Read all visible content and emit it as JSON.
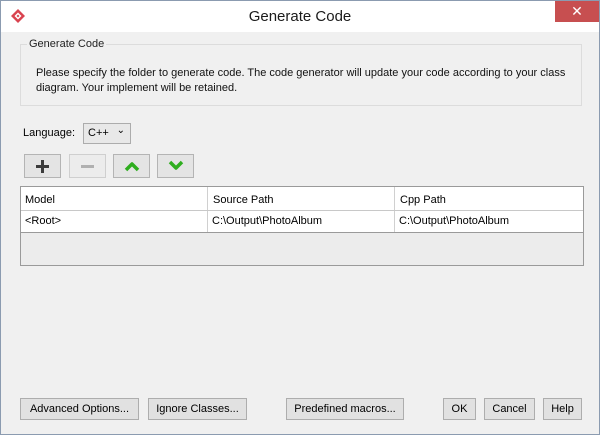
{
  "window": {
    "title": "Generate Code",
    "close_glyph": "✕"
  },
  "group": {
    "title": "Generate Code",
    "description": "Please specify the folder to generate code. The code generator will update your code according to your class diagram. Your implement will be retained."
  },
  "language": {
    "label": "Language:",
    "value": "C++"
  },
  "toolbar": {
    "add_icon": "plus-icon",
    "remove_icon": "minus-icon",
    "up_icon": "chevron-up-icon",
    "down_icon": "chevron-down-icon",
    "accent": "#2fae1f"
  },
  "table": {
    "columns": [
      "Model",
      "Source Path",
      "Cpp Path"
    ],
    "rows": [
      [
        "<Root>",
        "C:\\Output\\PhotoAlbum",
        "C:\\Output\\PhotoAlbum"
      ]
    ]
  },
  "buttons": {
    "advanced": "Advanced Options...",
    "ignore": "Ignore Classes...",
    "macros": "Predefined macros...",
    "ok": "OK",
    "cancel": "Cancel",
    "help": "Help"
  }
}
